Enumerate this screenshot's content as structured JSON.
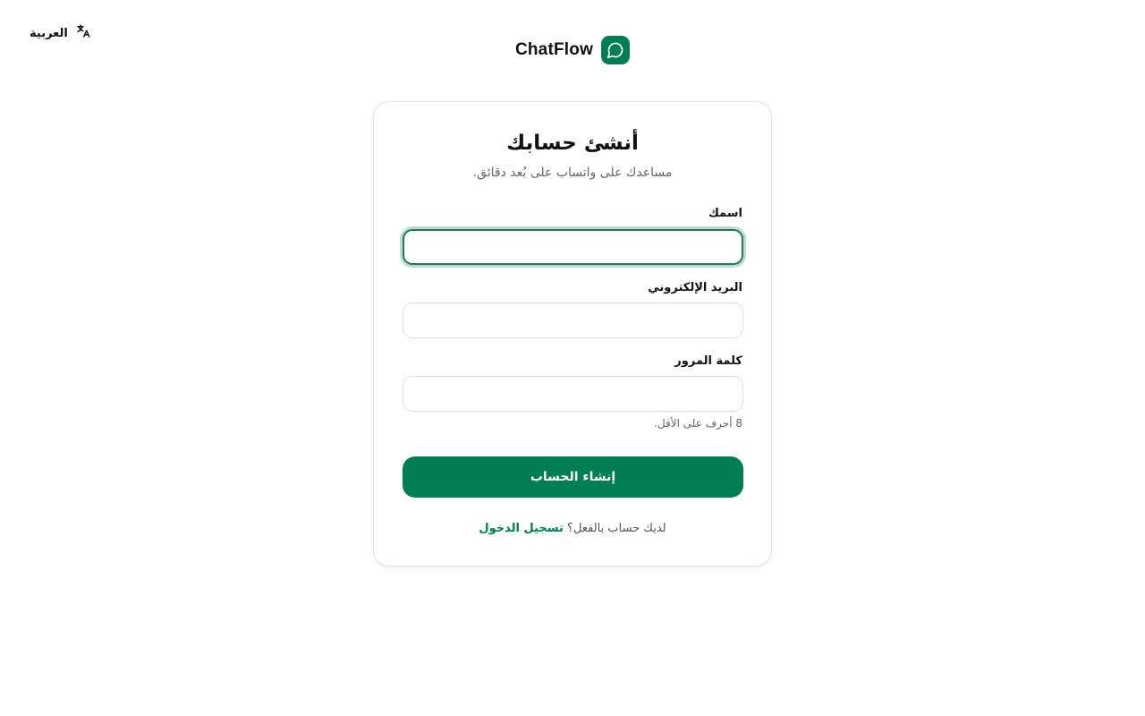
{
  "language_toggle": {
    "label": "العربية",
    "icon": "translate-icon"
  },
  "brand": {
    "name": "ChatFlow",
    "logo_icon": "chat-bubble-icon"
  },
  "signup": {
    "title": "أنشئ حسابك",
    "subtitle": "مساعدك على واتساب على بُعد دقائق.",
    "fields": {
      "name": {
        "label": "اسمك",
        "value": "",
        "placeholder": ""
      },
      "email": {
        "label": "البريد الإلكتروني",
        "value": "",
        "placeholder": ""
      },
      "password": {
        "label": "كلمة المرور",
        "value": "",
        "placeholder": "",
        "hint": "8 أحرف على الأقل."
      }
    },
    "submit_label": "إنشاء الحساب",
    "login_prompt": "لديك حساب بالفعل؟",
    "login_link": "تسجيل الدخول"
  },
  "colors": {
    "accent": "#007d52",
    "focus_ring": "#1e7a53"
  }
}
